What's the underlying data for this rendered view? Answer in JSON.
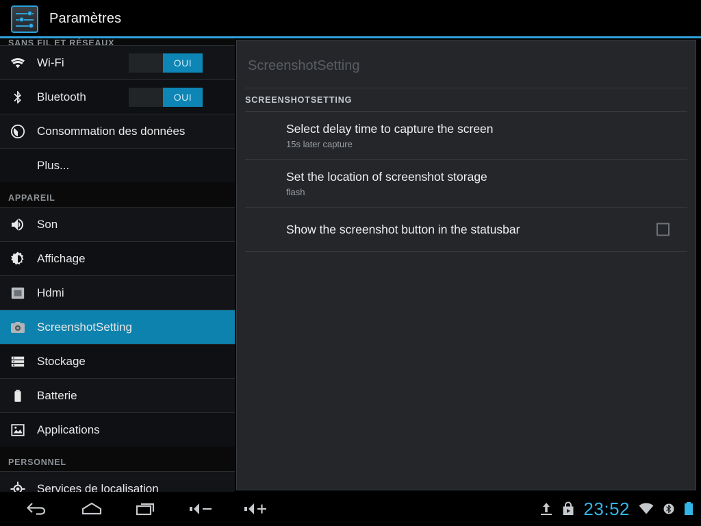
{
  "actionbar": {
    "icon": "settings-sliders-icon",
    "title": "Paramètres"
  },
  "sidebar": {
    "sections": [
      {
        "label": "SANS FIL ET RÉSEAUX",
        "clipped": true
      },
      {
        "label": "APPAREIL",
        "clipped": false
      },
      {
        "label": "PERSONNEL",
        "clipped": false
      }
    ],
    "items": [
      {
        "label": "Wi-Fi",
        "icon": "wifi-icon",
        "toggle": "OUI",
        "selected": false
      },
      {
        "label": "Bluetooth",
        "icon": "bluetooth-icon",
        "toggle": "OUI",
        "selected": false
      },
      {
        "label": "Consommation des données",
        "icon": "data-usage-icon",
        "toggle": null,
        "selected": false
      },
      {
        "label": "Plus...",
        "icon": null,
        "toggle": null,
        "selected": false
      },
      {
        "label": "Son",
        "icon": "sound-icon",
        "toggle": null,
        "selected": false
      },
      {
        "label": "Affichage",
        "icon": "display-brightness-icon",
        "toggle": null,
        "selected": false
      },
      {
        "label": "Hdmi",
        "icon": "hdmi-monitor-icon",
        "toggle": null,
        "selected": false
      },
      {
        "label": "ScreenshotSetting",
        "icon": "camera-icon",
        "toggle": null,
        "selected": true
      },
      {
        "label": "Stockage",
        "icon": "storage-icon",
        "toggle": null,
        "selected": false
      },
      {
        "label": "Batterie",
        "icon": "battery-icon",
        "toggle": null,
        "selected": false
      },
      {
        "label": "Applications",
        "icon": "applications-icon",
        "toggle": null,
        "selected": false
      },
      {
        "label": "Services de localisation",
        "icon": "location-icon",
        "toggle": null,
        "selected": false
      }
    ]
  },
  "content": {
    "panel_title": "ScreenshotSetting",
    "section_header": "SCREENSHOTSETTING",
    "preferences": [
      {
        "title": "Select delay time to capture the screen",
        "summary": "15s later capture",
        "checkbox": null
      },
      {
        "title": "Set the location of screenshot storage",
        "summary": "flash",
        "checkbox": null
      },
      {
        "title": "Show the screenshot button in the statusbar",
        "summary": null,
        "checkbox": "unchecked"
      }
    ]
  },
  "systembar": {
    "nav": [
      {
        "name": "back-icon",
        "label": "Retour"
      },
      {
        "name": "home-icon",
        "label": "Accueil"
      },
      {
        "name": "recents-icon",
        "label": "Applications récentes"
      },
      {
        "name": "volume-down-icon",
        "label": "Volume -"
      },
      {
        "name": "volume-up-icon",
        "label": "Volume +"
      }
    ],
    "status": {
      "upload_icon": "upload-icon",
      "store_icon": "play-store-icon",
      "clock": "23:52",
      "wifi_icon": "wifi-status-icon",
      "bluetooth_icon": "bluetooth-status-icon",
      "battery_icon": "battery-status-icon"
    }
  },
  "colors": {
    "accent": "#2fa3dd",
    "selected_row": "#0e82ae",
    "toggle_on": "#0e86b5",
    "clock": "#33b5e5",
    "panel_bg": "#24262a",
    "sidebar_bg": "#121417"
  }
}
